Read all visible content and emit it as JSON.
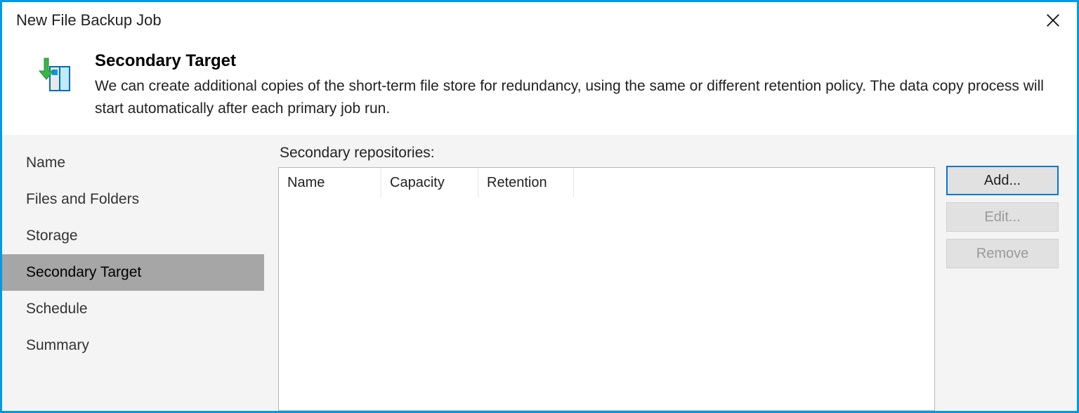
{
  "window": {
    "title": "New File Backup Job"
  },
  "header": {
    "title": "Secondary Target",
    "description": "We can create additional copies of the short-term file store for redundancy, using the same or different retention policy. The data copy process will start automatically after each primary job run."
  },
  "nav": {
    "items": [
      {
        "label": "Name",
        "active": false
      },
      {
        "label": "Files and Folders",
        "active": false
      },
      {
        "label": "Storage",
        "active": false
      },
      {
        "label": "Secondary Target",
        "active": true
      },
      {
        "label": "Schedule",
        "active": false
      },
      {
        "label": "Summary",
        "active": false
      }
    ]
  },
  "content": {
    "list_label": "Secondary repositories:",
    "columns": {
      "name": "Name",
      "capacity": "Capacity",
      "retention": "Retention"
    },
    "rows": [],
    "buttons": {
      "add": {
        "label": "Add...",
        "enabled": true,
        "primary": true
      },
      "edit": {
        "label": "Edit...",
        "enabled": false
      },
      "remove": {
        "label": "Remove",
        "enabled": false
      }
    }
  }
}
